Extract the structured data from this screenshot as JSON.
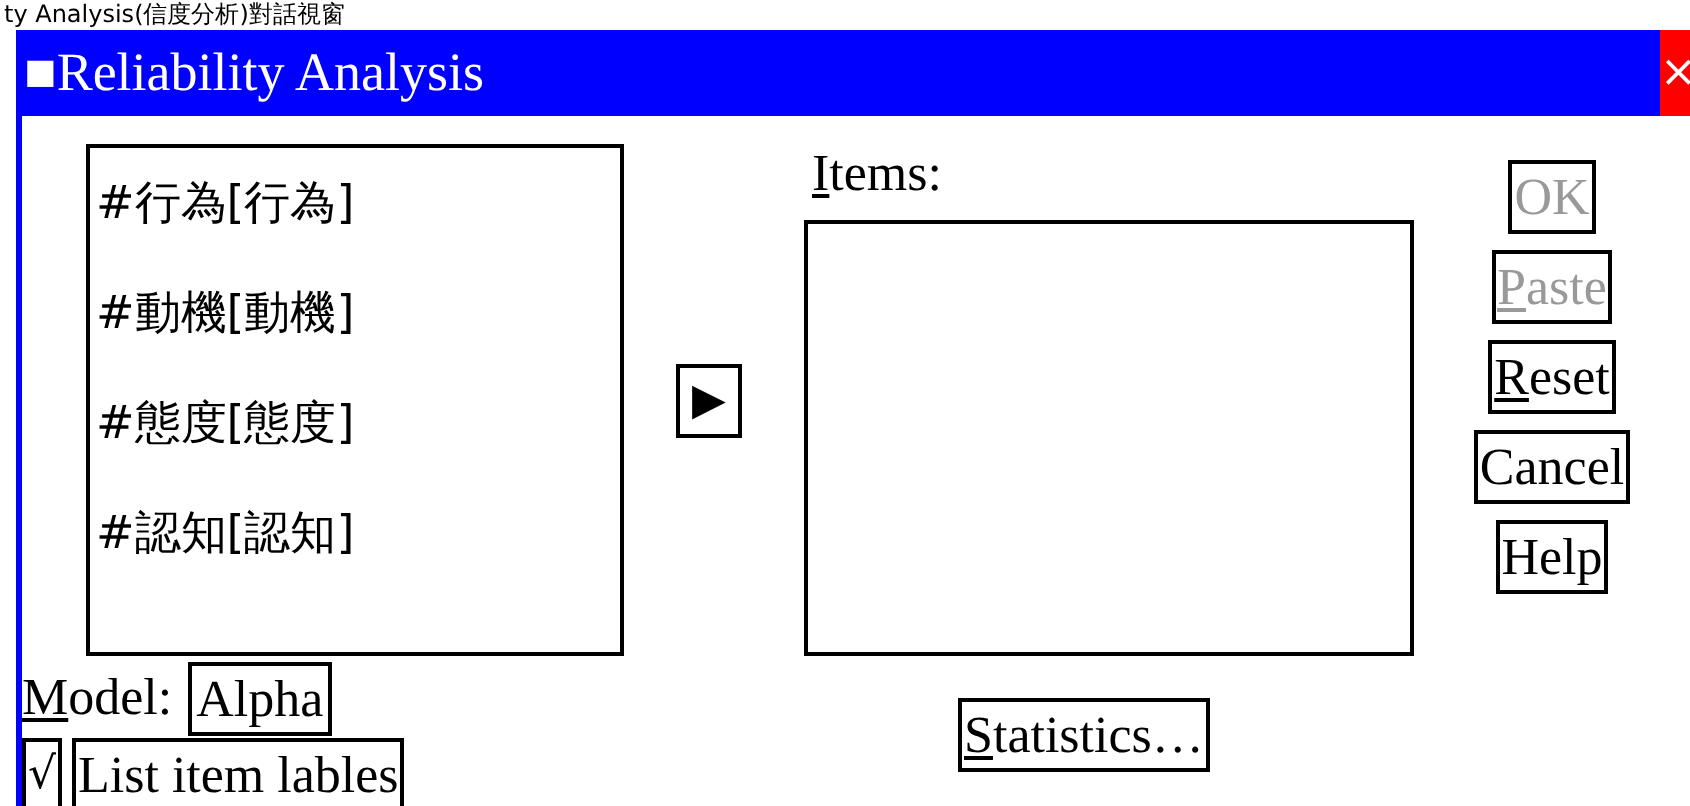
{
  "caption": "ty Analysis(信度分析)對話視窗",
  "window": {
    "title": "Reliability Analysis",
    "title_icon": "■",
    "close": "×"
  },
  "variables": [
    {
      "label": "#行為[行為]"
    },
    {
      "label": "#動機[動機]"
    },
    {
      "label": "#態度[態度]"
    },
    {
      "label": "#認知[認知]"
    }
  ],
  "move_button": "▶",
  "items": {
    "label_key": "I",
    "label_rest": "tems:"
  },
  "buttons": [
    {
      "rest": "OK",
      "disabled": true
    },
    {
      "key": "P",
      "rest": "aste",
      "disabled": true
    },
    {
      "key": "R",
      "rest": "eset",
      "disabled": false
    },
    {
      "rest": "Cancel",
      "disabled": false
    },
    {
      "rest": "Help",
      "disabled": false
    }
  ],
  "model": {
    "label_key": "M",
    "label_rest": "odel:",
    "value": "Alpha"
  },
  "list_item_labels": {
    "checked": true,
    "mark": "√",
    "label": "List item lables"
  },
  "statistics_button": {
    "key": "S",
    "rest": "tatistics…"
  }
}
